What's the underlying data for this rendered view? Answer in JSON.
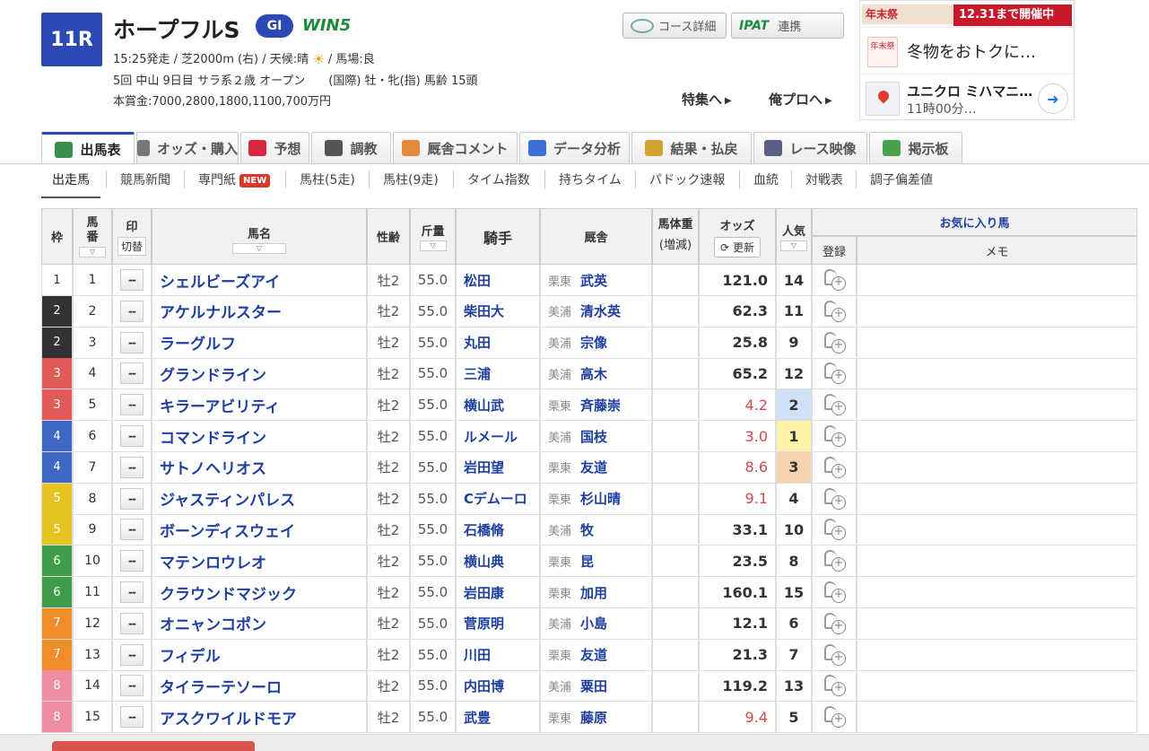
{
  "race": {
    "number": "11R",
    "name": "ホープフルS",
    "grade": "GI",
    "win5": "WIN5",
    "info_line1_a": "15:25発走 / 芝2000m (右) / 天候:晴",
    "info_line1_b": "/ 馬場:良",
    "info_line2": "5回 中山 9日目 サラ系２歳 オープン　　(国際) 牡・牝(指) 馬齢 15頭",
    "info_line3": "本賞金:7000,2800,1800,1100,700万円"
  },
  "buttons": {
    "course": "コース詳細",
    "ipat_logo": "IPAT",
    "ipat": "連携",
    "feature": "特集へ",
    "pro": "俺プロへ"
  },
  "ad": {
    "banner_left": "年末祭",
    "banner_right": "12.31まで開催中",
    "thumb1": "年末祭",
    "text1": "冬物をおトクに…",
    "text2a": "ユニクロ ミハマニ…",
    "text2b": "11時00分…"
  },
  "tabs": [
    {
      "label": "出馬表",
      "color": "#3a8f4a"
    },
    {
      "label": "オッズ・購入",
      "color": "#777777"
    },
    {
      "label": "予想",
      "color": "#d7263d"
    },
    {
      "label": "調教",
      "color": "#555555"
    },
    {
      "label": "厩舎コメント",
      "color": "#e58a3a"
    },
    {
      "label": "データ分析",
      "color": "#3a6fd8"
    },
    {
      "label": "結果・払戻",
      "color": "#d1a431"
    },
    {
      "label": "レース映像",
      "color": "#5a5f8a"
    },
    {
      "label": "掲示板",
      "color": "#46a34c"
    }
  ],
  "subnav": [
    "出走馬",
    "競馬新聞",
    "専門紙",
    "馬柱(5走)",
    "馬柱(9走)",
    "タイム指数",
    "持ちタイム",
    "パドック速報",
    "血統",
    "対戦表",
    "調子偏差値"
  ],
  "new_badge": "NEW",
  "headers": {
    "waku": "枠",
    "umaban": "馬番",
    "mark": "印",
    "mark_toggle": "切替",
    "horse": "馬名",
    "sex": "性齢",
    "kin": "斤量",
    "jockey": "騎手",
    "stable": "厩舎",
    "weight": "馬体重",
    "weight_sub": "(増減)",
    "odds": "オッズ",
    "refresh": "更新",
    "pop": "人気",
    "fav": "お気に入り馬",
    "reg": "登録",
    "memo": "メモ"
  },
  "mark_label": "--",
  "colors": {
    "waku1": "#ffffff",
    "waku2": "#333333",
    "waku3": "#e05a5a",
    "waku4": "#3f67c4",
    "waku5": "#e6c420",
    "waku6": "#3f9d4a",
    "waku7": "#ef8c2c",
    "waku8": "#ef8ea0",
    "pop1": "#fff3a8",
    "pop2": "#cfe0f8",
    "pop3": "#f7d2b0"
  },
  "entries": [
    {
      "waku": "1",
      "umaban": "1",
      "horse": "シェルビーズアイ",
      "sex": "牡2",
      "kin": "55.0",
      "jockey": "松田",
      "region": "栗東",
      "trainer": "武英",
      "odds": "121.0",
      "pop": "14"
    },
    {
      "waku": "2",
      "umaban": "2",
      "horse": "アケルナルスター",
      "sex": "牡2",
      "kin": "55.0",
      "jockey": "柴田大",
      "region": "美浦",
      "trainer": "清水英",
      "odds": "62.3",
      "pop": "11"
    },
    {
      "waku": "2",
      "umaban": "3",
      "horse": "ラーグルフ",
      "sex": "牡2",
      "kin": "55.0",
      "jockey": "丸田",
      "region": "美浦",
      "trainer": "宗像",
      "odds": "25.8",
      "pop": "9"
    },
    {
      "waku": "3",
      "umaban": "4",
      "horse": "グランドライン",
      "sex": "牡2",
      "kin": "55.0",
      "jockey": "三浦",
      "region": "美浦",
      "trainer": "高木",
      "odds": "65.2",
      "pop": "12"
    },
    {
      "waku": "3",
      "umaban": "5",
      "horse": "キラーアビリティ",
      "sex": "牡2",
      "kin": "55.0",
      "jockey": "横山武",
      "region": "栗東",
      "trainer": "斉藤崇",
      "odds": "4.2",
      "pop": "2"
    },
    {
      "waku": "4",
      "umaban": "6",
      "horse": "コマンドライン",
      "sex": "牡2",
      "kin": "55.0",
      "jockey": "ルメール",
      "region": "美浦",
      "trainer": "国枝",
      "odds": "3.0",
      "pop": "1"
    },
    {
      "waku": "4",
      "umaban": "7",
      "horse": "サトノヘリオス",
      "sex": "牡2",
      "kin": "55.0",
      "jockey": "岩田望",
      "region": "栗東",
      "trainer": "友道",
      "odds": "8.6",
      "pop": "3"
    },
    {
      "waku": "5",
      "umaban": "8",
      "horse": "ジャスティンパレス",
      "sex": "牡2",
      "kin": "55.0",
      "jockey": "Cデムーロ",
      "region": "栗東",
      "trainer": "杉山晴",
      "odds": "9.1",
      "pop": "4"
    },
    {
      "waku": "5",
      "umaban": "9",
      "horse": "ボーンディスウェイ",
      "sex": "牡2",
      "kin": "55.0",
      "jockey": "石橋脩",
      "region": "美浦",
      "trainer": "牧",
      "odds": "33.1",
      "pop": "10"
    },
    {
      "waku": "6",
      "umaban": "10",
      "horse": "マテンロウレオ",
      "sex": "牡2",
      "kin": "55.0",
      "jockey": "横山典",
      "region": "栗東",
      "trainer": "昆",
      "odds": "23.5",
      "pop": "8"
    },
    {
      "waku": "6",
      "umaban": "11",
      "horse": "クラウンドマジック",
      "sex": "牡2",
      "kin": "55.0",
      "jockey": "岩田康",
      "region": "栗東",
      "trainer": "加用",
      "odds": "160.1",
      "pop": "15"
    },
    {
      "waku": "7",
      "umaban": "12",
      "horse": "オニャンコポン",
      "sex": "牡2",
      "kin": "55.0",
      "jockey": "菅原明",
      "region": "美浦",
      "trainer": "小島",
      "odds": "12.1",
      "pop": "6"
    },
    {
      "waku": "7",
      "umaban": "13",
      "horse": "フィデル",
      "sex": "牡2",
      "kin": "55.0",
      "jockey": "川田",
      "region": "栗東",
      "trainer": "友道",
      "odds": "21.3",
      "pop": "7"
    },
    {
      "waku": "8",
      "umaban": "14",
      "horse": "タイラーテソーロ",
      "sex": "牡2",
      "kin": "55.0",
      "jockey": "内田博",
      "region": "美浦",
      "trainer": "粟田",
      "odds": "119.2",
      "pop": "13"
    },
    {
      "waku": "8",
      "umaban": "15",
      "horse": "アスクワイルドモア",
      "sex": "牡2",
      "kin": "55.0",
      "jockey": "武豊",
      "region": "栗東",
      "trainer": "藤原",
      "odds": "9.4",
      "pop": "5"
    }
  ]
}
